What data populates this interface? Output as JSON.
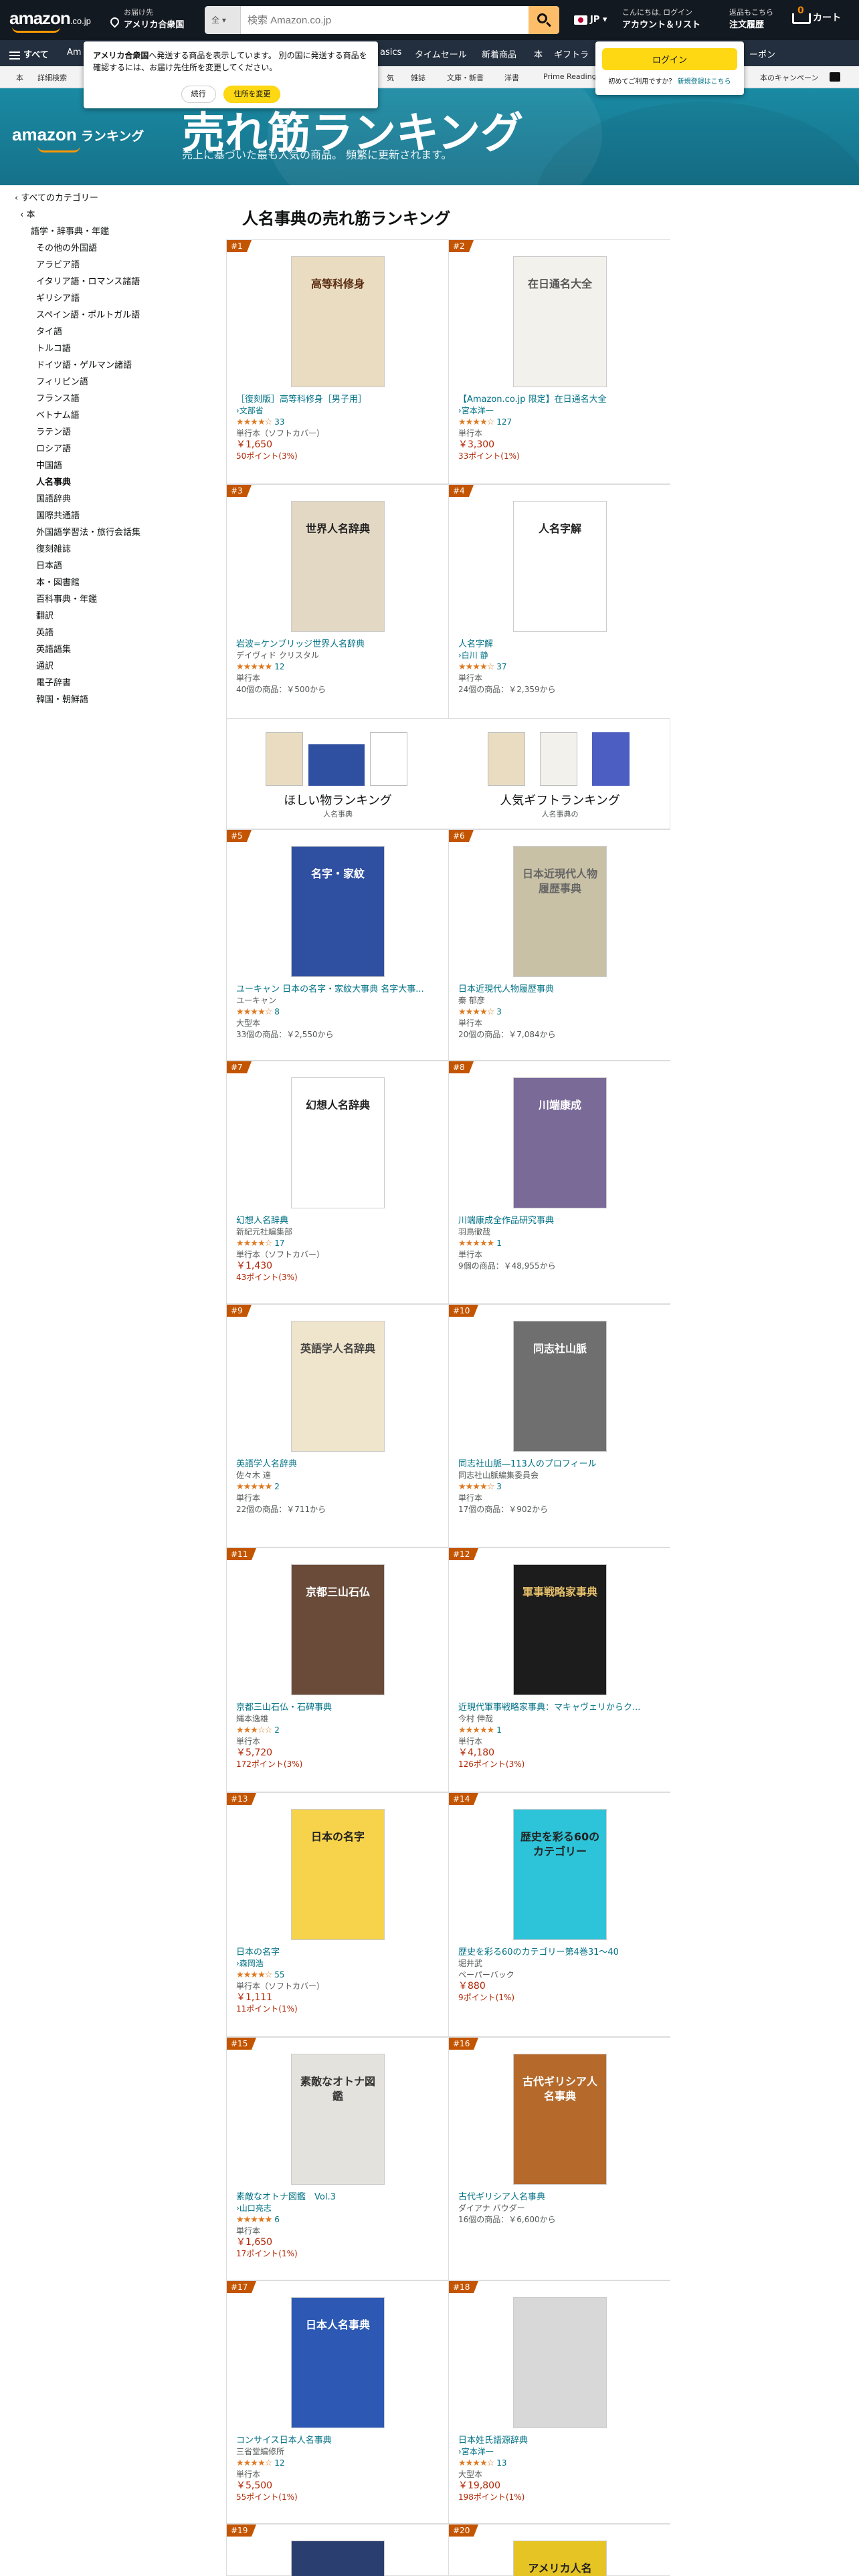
{
  "nav": {
    "logo": "amazon",
    "logo_suffix": ".co.jp",
    "deliver_line1": "お届け先",
    "deliver_line2": "アメリカ合衆国",
    "search_category": "全",
    "search_placeholder": "検索 Amazon.co.jp",
    "language": "JP",
    "account_line1": "こんにちは, ログイン",
    "account_line2": "アカウント＆リスト",
    "orders_line1": "返品もこちら",
    "orders_line2": "注文履歴",
    "cart_count": "0",
    "cart_label": "カート"
  },
  "subnav": {
    "all_label": "すべて",
    "items": [
      "Am",
      "asics",
      "タイムセール",
      "新着商品",
      "本",
      "ギフトラ",
      "ーポン"
    ]
  },
  "subnav2": {
    "items": [
      "本",
      "詳細検索",
      "気",
      "雑誌",
      "文庫・新書",
      "洋書",
      "Prime Reading",
      "本のキャンペーン"
    ]
  },
  "popup": {
    "text_bold": "アメリカ合衆国",
    "text": "へ発送する商品を表示しています。 別の国に発送する商品を確認するには、お届け先住所を変更してください。",
    "continue": "続行",
    "change": "住所を変更"
  },
  "signin": {
    "button": "ログイン",
    "text": "初めてご利用ですか？",
    "link": "新規登録はこちら"
  },
  "banner": {
    "logo": "amazon",
    "logo_word": "ランキング",
    "title": "売れ筋ランキング",
    "subtitle": "売上に基づいた最も人気の商品。 頻繁に更新されます。"
  },
  "sidebar": {
    "all": "‹ すべてのカテゴリー",
    "parent": "‹ 本",
    "items": [
      "語学・辞事典・年鑑",
      "その他の外国語",
      "アラビア語",
      "イタリア語・ロマンス諸語",
      "ギリシア語",
      "スペイン語・ポルトガル語",
      "タイ語",
      "トルコ語",
      "ドイツ語・ゲルマン諸語",
      "フィリピン語",
      "フランス語",
      "ベトナム語",
      "ラテン語",
      "ロシア語",
      "中国語",
      "人名事典",
      "国語辞典",
      "国際共通語",
      "外国語学習法・旅行会話集",
      "復刻雑誌",
      "日本語",
      "本・図書館",
      "百科事典・年鑑",
      "翻訳",
      "英語",
      "英語語集",
      "通訳",
      "電子辞書",
      "韓国・朝鮮語"
    ]
  },
  "main_title": "人名事典の売れ筋ランキング",
  "promo": [
    {
      "title": "ほしい物ランキング",
      "sub": "人名事典"
    },
    {
      "title": "人気ギフトランキング",
      "sub": "人名事典の"
    }
  ],
  "items": [
    {
      "rank": "#1",
      "title": "［復刻版］高等科修身［男子用］",
      "author": "›文部省",
      "author_link": true,
      "stars": "★★★★☆",
      "rating": 4.0,
      "reviews": "33",
      "format": "単行本（ソフトカバー）",
      "price": "￥1,650",
      "points": "50ポイント(3%)",
      "used": ""
    },
    {
      "rank": "#2",
      "title": "【Amazon.co.jp 限定】在日通名大全",
      "author": "›宮本洋一",
      "author_link": true,
      "stars": "★★★★☆",
      "rating": 4.0,
      "reviews": "127",
      "format": "単行本",
      "price": "￥3,300",
      "points": "33ポイント(1%)",
      "used": ""
    },
    {
      "rank": "#3",
      "title": "岩波=ケンブリッジ世界人名辞典",
      "author": "デイヴィド クリスタル",
      "author_link": false,
      "stars": "★★★★★",
      "rating": 4.5,
      "reviews": "12",
      "format": "単行本",
      "price": "",
      "points": "",
      "used": "40個の商品：￥500から"
    },
    {
      "rank": "#4",
      "title": "人名字解",
      "author": "›白川 静",
      "author_link": true,
      "stars": "★★★★☆",
      "rating": 4.0,
      "reviews": "37",
      "format": "単行本",
      "price": "",
      "points": "",
      "used": "24個の商品：￥2,359から"
    },
    {
      "rank": "#5",
      "title": "ユーキャン 日本の名字・家紋大事典 名字大事...",
      "author": "ユーキャン",
      "author_link": false,
      "stars": "★★★★☆",
      "rating": 3.5,
      "reviews": "8",
      "format": "大型本",
      "price": "",
      "points": "",
      "used": "33個の商品：￥2,550から"
    },
    {
      "rank": "#6",
      "title": "日本近現代人物履歴事典",
      "author": "秦 郁彦",
      "author_link": false,
      "stars": "★★★★☆",
      "rating": 3.5,
      "reviews": "3",
      "format": "単行本",
      "price": "",
      "points": "",
      "used": "20個の商品：￥7,084から"
    },
    {
      "rank": "#7",
      "title": "幻想人名辞典",
      "author": "新紀元社編集部",
      "author_link": false,
      "stars": "★★★★☆",
      "rating": 4.0,
      "reviews": "17",
      "format": "単行本（ソフトカバー）",
      "price": "￥1,430",
      "points": "43ポイント(3%)",
      "used": ""
    },
    {
      "rank": "#8",
      "title": "川端康成全作品研究事典",
      "author": "羽鳥徹哉",
      "author_link": false,
      "stars": "★★★★★",
      "rating": 5.0,
      "reviews": "1",
      "format": "単行本",
      "price": "",
      "points": "",
      "used": "9個の商品：￥48,955から"
    },
    {
      "rank": "#9",
      "title": "英語学人名辞典",
      "author": "佐々木 達",
      "author_link": false,
      "stars": "★★★★★",
      "rating": 4.5,
      "reviews": "2",
      "format": "単行本",
      "price": "",
      "points": "",
      "used": "22個の商品：￥711から"
    },
    {
      "rank": "#10",
      "title": "同志社山脈―113人のプロフィール",
      "author": "同志社山脈編集委員会",
      "author_link": false,
      "stars": "★★★★☆",
      "rating": 4.0,
      "reviews": "3",
      "format": "単行本",
      "price": "",
      "points": "",
      "used": "17個の商品：￥902から"
    },
    {
      "rank": "#11",
      "title": "京都三山石仏・石碑事典",
      "author": "縄本逸雄",
      "author_link": false,
      "stars": "★★★☆☆",
      "rating": 3.0,
      "reviews": "2",
      "format": "単行本",
      "price": "￥5,720",
      "points": "172ポイント(3%)",
      "used": ""
    },
    {
      "rank": "#12",
      "title": "近現代軍事戦略家事典：マキャヴェリからク...",
      "author": "今村 伸哉",
      "author_link": false,
      "stars": "★★★★★",
      "rating": 5.0,
      "reviews": "1",
      "format": "単行本",
      "price": "￥4,180",
      "points": "126ポイント(3%)",
      "used": ""
    },
    {
      "rank": "#13",
      "title": "日本の名字",
      "author": "›森岡浩",
      "author_link": true,
      "stars": "★★★★☆",
      "rating": 4.0,
      "reviews": "55",
      "format": "単行本（ソフトカバー）",
      "price": "￥1,111",
      "points": "11ポイント(1%)",
      "used": ""
    },
    {
      "rank": "#14",
      "title": "歴史を彩る60のカテゴリー第4巻31～40",
      "author": "堀井武",
      "author_link": false,
      "stars": "",
      "rating": 0,
      "reviews": "",
      "format": "ペーパーバック",
      "price": "￥880",
      "points": "9ポイント(1%)",
      "used": ""
    },
    {
      "rank": "#15",
      "title": "素敵なオトナ図鑑　Vol.3",
      "author": "›山口亮志",
      "author_link": true,
      "stars": "★★★★★",
      "rating": 5.0,
      "reviews": "6",
      "format": "単行本",
      "price": "￥1,650",
      "points": "17ポイント(1%)",
      "used": ""
    },
    {
      "rank": "#16",
      "title": "古代ギリシア人名事典",
      "author": "ダイアナ バウダー",
      "author_link": false,
      "stars": "",
      "rating": 0,
      "reviews": "",
      "format": "",
      "price": "",
      "points": "",
      "used": "16個の商品：￥6,600から"
    },
    {
      "rank": "#17",
      "title": "コンサイス日本人名事典",
      "author": "三省堂編修所",
      "author_link": false,
      "stars": "★★★★☆",
      "rating": 4.0,
      "reviews": "12",
      "format": "単行本",
      "price": "￥5,500",
      "points": "55ポイント(1%)",
      "used": ""
    },
    {
      "rank": "#18",
      "title": "日本姓氏語源辞典",
      "author": "›宮本洋一",
      "author_link": true,
      "stars": "★★★★☆",
      "rating": 3.5,
      "reviews": "13",
      "format": "大型本",
      "price": "￥19,800",
      "points": "198ポイント(1%)",
      "used": ""
    },
    {
      "rank": "#19",
      "title": "",
      "author": "",
      "author_link": false,
      "stars": "",
      "rating": 0,
      "reviews": "",
      "format": "",
      "price": "",
      "points": "",
      "used": ""
    },
    {
      "rank": "#20",
      "title": "",
      "author": "",
      "author_link": false,
      "stars": "",
      "rating": 0,
      "reviews": "",
      "format": "",
      "price": "",
      "points": "",
      "used": ""
    }
  ],
  "covers": [
    {
      "bg": "#e9dcc0",
      "text": "高等科修身",
      "fg": "#5a2b10"
    },
    {
      "bg": "#f3f1ec",
      "text": "在日通名大全",
      "fg": "#555"
    },
    {
      "bg": "#e2d8c4",
      "text": "世界人名辞典",
      "fg": "#222"
    },
    {
      "bg": "#ffffff",
      "text": "人名字解",
      "fg": "#222"
    },
    {
      "bg": "#2f4fa0",
      "text": "名字・家紋",
      "fg": "#fff"
    },
    {
      "bg": "#c9c1a6",
      "text": "日本近現代人物履歴事典",
      "fg": "#666"
    },
    {
      "bg": "#ffffff",
      "text": "幻想人名辞典",
      "fg": "#222"
    },
    {
      "bg": "#7a6a98",
      "text": "川端康成",
      "fg": "#fff"
    },
    {
      "bg": "#efe4cc",
      "text": "英語学人名辞典",
      "fg": "#444"
    },
    {
      "bg": "#6f6f6f",
      "text": "同志社山脈",
      "fg": "#fff"
    },
    {
      "bg": "#6a4b3a",
      "text": "京都三山石仏",
      "fg": "#fff"
    },
    {
      "bg": "#1c1c1c",
      "text": "軍事戦略家事典",
      "fg": "#e7c16c"
    },
    {
      "bg": "#f6d34a",
      "text": "日本の名字",
      "fg": "#222"
    },
    {
      "bg": "#2dc3d8",
      "text": "歴史を彩る60のカテゴリー",
      "fg": "#222"
    },
    {
      "bg": "#e4e2dc",
      "text": "素敵なオトナ図鑑",
      "fg": "#333"
    },
    {
      "bg": "#b56a2c",
      "text": "古代ギリシア人名事典",
      "fg": "#fff"
    },
    {
      "bg": "#2d58b3",
      "text": "日本人名事典",
      "fg": "#fff"
    },
    {
      "bg": "#d8d8d8",
      "text": "",
      "fg": "#333"
    },
    {
      "bg": "#2a3f70",
      "text": "",
      "fg": "#fff"
    },
    {
      "bg": "#e6c423",
      "text": "アメリカ人名",
      "fg": "#222"
    }
  ]
}
